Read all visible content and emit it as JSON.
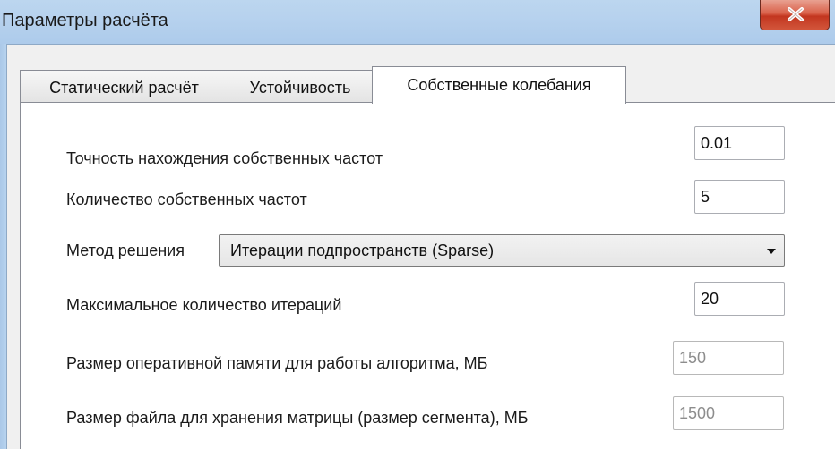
{
  "window": {
    "title": "Параметры расчёта"
  },
  "tabs": [
    {
      "label": "Статический расчёт",
      "active": false
    },
    {
      "label": "Устойчивость",
      "active": false
    },
    {
      "label": "Собственные колебания",
      "active": true
    }
  ],
  "form": {
    "accuracy": {
      "label": "Точность нахождения собственных частот",
      "value": "0.01"
    },
    "frequency_count": {
      "label": "Количество собственных частот",
      "value": "5"
    },
    "method": {
      "label": "Метод решения",
      "selected": "Итерации подпространств (Sparse)"
    },
    "max_iterations": {
      "label": "Максимальное количество итераций",
      "value": "20"
    },
    "memory_size": {
      "label": "Размер оперативной памяти для работы алгоритма, МБ",
      "value": "150",
      "disabled": true
    },
    "file_size": {
      "label": "Размер файла для хранения матрицы (размер сегмента), МБ",
      "value": "1500",
      "disabled": true
    }
  },
  "icons": {
    "close": "close-icon",
    "dropdown": "chevron-down-icon"
  },
  "colors": {
    "titlebar": "#b7d2ee",
    "close_button": "#c2361f",
    "panel_bg": "#ffffff",
    "dialog_bg": "#f0f0f0"
  }
}
